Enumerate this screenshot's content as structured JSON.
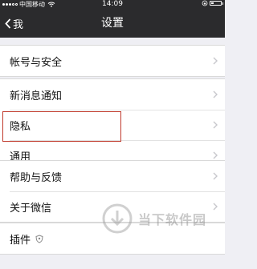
{
  "status_bar": {
    "carrier": "中国移动",
    "time": "14:09",
    "battery_level": 0.25
  },
  "navbar": {
    "back_label": "我",
    "title": "设置"
  },
  "groups": [
    {
      "items": [
        {
          "label": "帐号与安全",
          "icon": "chevron-right-icon"
        }
      ]
    },
    {
      "items": [
        {
          "label": "新消息通知",
          "icon": "chevron-right-icon"
        },
        {
          "label": "隐私",
          "icon": "chevron-right-icon",
          "highlighted": true
        },
        {
          "label": "通用",
          "icon": "chevron-right-icon"
        }
      ]
    },
    {
      "items": [
        {
          "label": "帮助与反馈",
          "icon": "chevron-right-icon"
        },
        {
          "label": "关于微信",
          "icon": "chevron-right-icon"
        }
      ]
    },
    {
      "items": [
        {
          "label": "插件",
          "badge_icon": "shield-icon"
        }
      ]
    }
  ],
  "watermark": {
    "text": "当下软件园",
    "icon": "download-logo-icon"
  },
  "colors": {
    "navbar_bg": "#2b2b2d",
    "page_bg": "#efeff4",
    "highlight_border": "#c0392b"
  }
}
